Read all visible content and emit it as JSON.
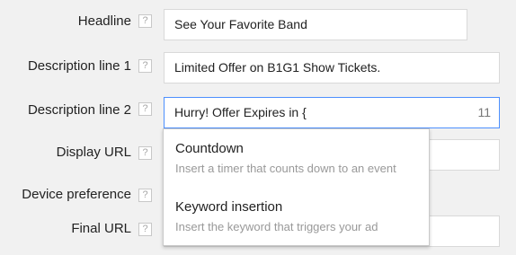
{
  "form": {
    "headline": {
      "label": "Headline",
      "help": "?",
      "value": "See Your Favorite Band"
    },
    "description1": {
      "label": "Description line 1",
      "help": "?",
      "value": "Limited Offer on B1G1 Show Tickets."
    },
    "description2": {
      "label": "Description line 2",
      "help": "?",
      "value": "Hurry! Offer Expires in {",
      "counter": "11"
    },
    "display_url": {
      "label": "Display URL",
      "help": "?",
      "value": ""
    },
    "device_preference": {
      "label": "Device preference",
      "help": "?"
    },
    "final_url": {
      "label": "Final URL",
      "help": "?",
      "value": ""
    }
  },
  "dropdown": {
    "items": [
      {
        "title": "Countdown",
        "description": "Insert a timer that counts down to an event"
      },
      {
        "title": "Keyword insertion",
        "description": "Insert the keyword that triggers your ad"
      }
    ]
  },
  "colors": {
    "focus_border": "#4d90fe",
    "background": "#f1f1f1"
  }
}
